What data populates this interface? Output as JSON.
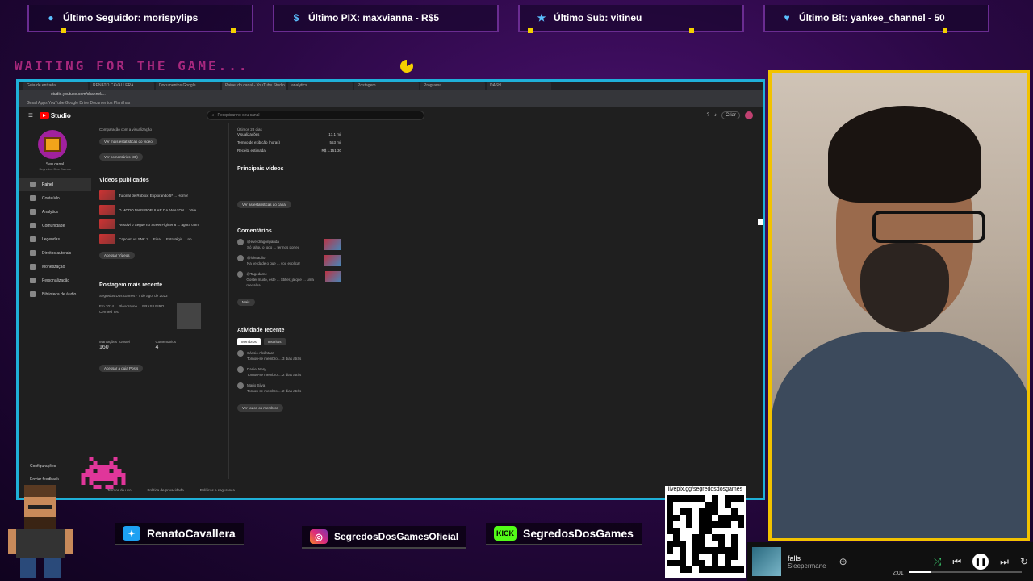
{
  "alerts": [
    {
      "label": "Último Seguidor: morispylips",
      "icon": "person-icon"
    },
    {
      "label": "Último PIX: maxvianna - R$5",
      "icon": "dollar-icon"
    },
    {
      "label": "Último Sub: vitineu",
      "icon": "star-icon"
    },
    {
      "label": "Último Bit: yankee_channel - 50",
      "icon": "heart-icon"
    }
  ],
  "waiting_text": "WAITING FOR THE GAME...",
  "browser": {
    "tabs": [
      "Guia de entrada",
      "RENATO CAVALLERA",
      "Documentos Google",
      "Painel do canal - YouTube Studio",
      "analytics",
      "Postagem",
      "Programa",
      "DASH"
    ],
    "url": "studio.youtube.com/channel/...",
    "bookmarks": "Gmail  Apps  YouTube  Google Drive  Documentos  Planilhas"
  },
  "studio": {
    "logo": "Studio",
    "search_placeholder": "Pesquisar no seu canal",
    "create_label": "Criar",
    "channel_name": "Seu canal",
    "channel_sub": "Segredos Dos Games",
    "nav": [
      "Painel",
      "Conteúdo",
      "Analytics",
      "Comunidade",
      "Legendas",
      "Direitos autorais",
      "Monetização",
      "Personalização",
      "Biblioteca de áudio"
    ],
    "settings_label": "Configurações",
    "feedback_label": "Enviar feedback",
    "col1": {
      "top_text": "Comparação com a visualização",
      "btn_stats": "Ver mais estatísticas do vídeo",
      "btn_comments": "Ver comentários (38)",
      "published_title": "Videos publicados",
      "videos": [
        "Tutorial de Roblox: Explorando 5ª ... Horror",
        "O MODO MAIS POPULAR DA AMAZON ... Vale",
        "Resolvi o Segue no Street Fighter 6 ... agora com",
        "Capcom vs SNK 2 ... Final ... Estratégia ... no"
      ],
      "btn_videos": "Acessar Vídeos",
      "post_title": "Postagem mais recente",
      "post_author": "Segredos Dos Games",
      "post_date": "7 de ago. de 2023",
      "post_body": "Em 2014 ... Bloodrayne ... BRASILEIRO ... Cermed Tec",
      "likes_label": "Marcações \"Gostei\"",
      "likes_value": "160",
      "comments_label": "Comentários",
      "comments_value": "4",
      "btn_post": "Acessar a guia Posts"
    },
    "col2": {
      "period": "Últimos 28 dias",
      "stats": [
        {
          "label": "Visualizações",
          "value": "17,1 mil"
        },
        {
          "label": "Tempo de exibição (horas)",
          "value": "553 mil"
        },
        {
          "label": "Receita estimada",
          "value": "R$ 1.151,30"
        }
      ],
      "top_videos_title": "Principais vídeos",
      "btn_analytics": "Ver as estatísticas do canal",
      "comments_title": "Comentários",
      "comments": [
        {
          "author": "@everdragonpanda",
          "text": "Só faltou o jogo ... termos por eu"
        },
        {
          "author": "@lukeadlio",
          "text": "Na verdade o que ... vou explicar"
        },
        {
          "author": "@Tagedame",
          "text": "Gostei muito, este ... Stifler, já que ... uma medalha"
        }
      ],
      "btn_more": "Mais",
      "activity_title": "Atividade recente",
      "activity_tabs": [
        "Membros",
        "Inscritos"
      ],
      "activity": [
        {
          "name": "Cássio Alcântara",
          "text": "Tornou-se membro ... 3 dias atrás"
        },
        {
          "name": "Daniel Nery",
          "text": "Tornou-se membro ... 2 dias atrás"
        },
        {
          "name": "Mario Silva",
          "text": "Tornou-se membro ... 2 dias atrás"
        }
      ],
      "btn_all": "Ver todos os membros"
    },
    "footer": [
      "Termos de uso",
      "Política de privacidade",
      "Políticas e segurança"
    ]
  },
  "social": {
    "twitter": "RenatoCavallera",
    "instagram": "SegredosDosGamesOficial",
    "kick_badge": "KICK",
    "kick": "SegredosDosGames",
    "qr_url": "livepix.gg/segredosdosgames"
  },
  "player": {
    "track": "falls",
    "artist": "Sleepermane",
    "time": "2:01",
    "progress": 0.2
  },
  "colors": {
    "accent": "#1fb0d8",
    "webcam_border": "#f2c200",
    "waiting": "#e0369a"
  }
}
